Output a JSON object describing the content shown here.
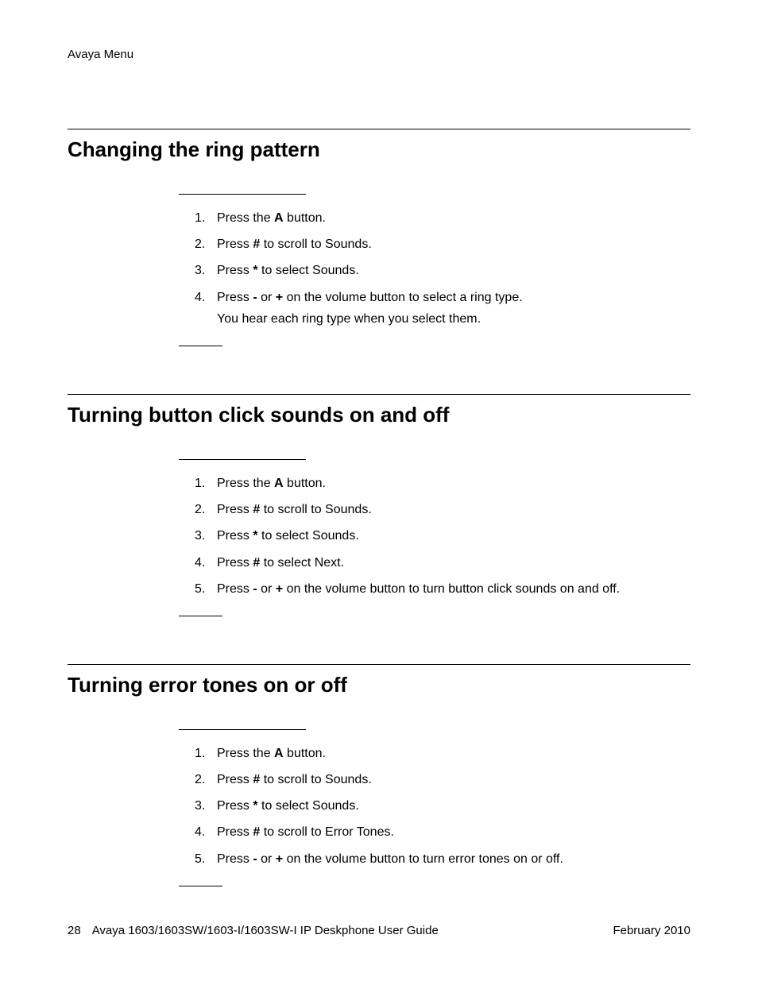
{
  "running_header": "Avaya Menu",
  "sections": [
    {
      "title": "Changing the ring pattern",
      "steps": [
        {
          "html": "Press the <b>A</b> button."
        },
        {
          "html": "Press <b>#</b> to scroll to Sounds."
        },
        {
          "html": "Press <b>*</b> to select Sounds."
        },
        {
          "html": "Press <b>-</b> or <b>+</b> on the volume button to select a ring type.",
          "sub": "You hear each ring type when you select them."
        }
      ]
    },
    {
      "title": "Turning button click sounds on and off",
      "steps": [
        {
          "html": "Press the <b>A</b> button."
        },
        {
          "html": "Press <b>#</b> to scroll to Sounds."
        },
        {
          "html": "Press <b>*</b> to select Sounds."
        },
        {
          "html": "Press <b>#</b> to select Next."
        },
        {
          "html": "Press <b>-</b> or <b>+</b> on the volume button to turn button click sounds on and off."
        }
      ]
    },
    {
      "title": "Turning error tones on or off",
      "steps": [
        {
          "html": "Press the <b>A</b> button."
        },
        {
          "html": "Press <b>#</b> to scroll to Sounds."
        },
        {
          "html": "Press <b>*</b> to select Sounds."
        },
        {
          "html": "Press <b>#</b> to scroll to Error Tones."
        },
        {
          "html": "Press <b>-</b> or <b>+</b> on the volume button to turn error tones on or off."
        }
      ]
    }
  ],
  "footer": {
    "page_number": "28",
    "guide_title": "Avaya 1603/1603SW/1603-I/1603SW-I IP Deskphone User Guide",
    "date": "February 2010"
  }
}
